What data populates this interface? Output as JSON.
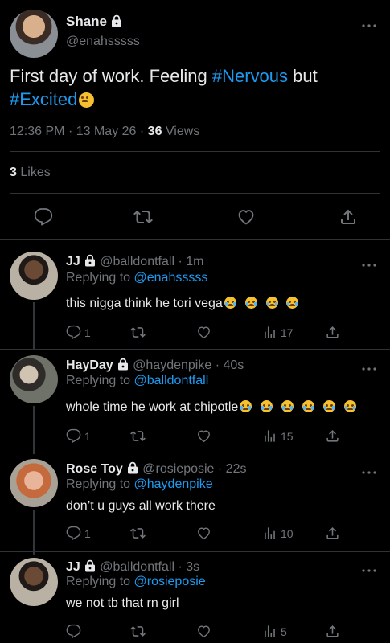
{
  "tweet": {
    "name": "Shane",
    "handle": "@enahsssss",
    "text_plain": "First day of work. Feeling ",
    "hashtag1": "#Nervous",
    "text_mid": " but",
    "hashtag2": "#Excited",
    "time": "12:36 PM",
    "dot1": "·",
    "date": "13 May 26",
    "dot2": "·",
    "views_count": "36",
    "views_label": "Views",
    "likes_count": "3",
    "likes_label": "Likes"
  },
  "replies": [
    {
      "name": "JJ",
      "handle": "@balldontfall",
      "time": "· 1m",
      "replying_label": "Replying to",
      "replying_to": "@enahsssss",
      "text": "this nigga think he tori vega",
      "reply_count": "1",
      "views": "17",
      "avatar_color": "#4a3a2a"
    },
    {
      "name": "HayDay",
      "handle": "@haydenpike",
      "time": "· 40s",
      "replying_label": "Replying to",
      "replying_to": "@balldontfall",
      "text": "whole time he work at chipotle",
      "reply_count": "1",
      "views": "15",
      "avatar_color": "#5a5f55"
    },
    {
      "name": "Rose Toy",
      "handle": "@rosieposie",
      "time": "· 22s",
      "replying_label": "Replying to",
      "replying_to": "@haydenpike",
      "text": "don’t u guys all work there",
      "reply_count": "1",
      "views": "10",
      "avatar_color": "#c78a66"
    },
    {
      "name": "JJ",
      "handle": "@balldontfall",
      "time": "· 3s",
      "replying_label": "Replying to",
      "replying_to": "@rosieposie",
      "text": "we not tb that rn girl",
      "reply_count": "",
      "views": "5",
      "avatar_color": "#4a3a2a"
    }
  ],
  "colors": {
    "background": "#000000",
    "link": "#1d9bf0",
    "muted": "#71767b",
    "text": "#e7e9ea"
  },
  "icons": {
    "lock": "lock-icon",
    "more": "more-icon",
    "reply": "reply-icon",
    "retweet": "retweet-icon",
    "like": "like-icon",
    "share": "share-icon",
    "views": "views-icon"
  }
}
